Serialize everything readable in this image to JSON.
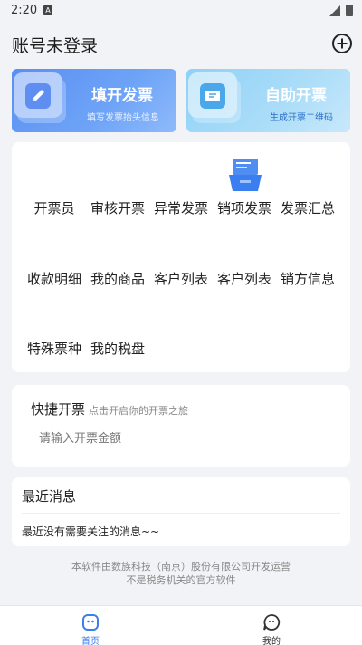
{
  "status": {
    "time": "2:20",
    "badge": "A"
  },
  "header": {
    "title": "账号未登录"
  },
  "cards": {
    "fill": {
      "title": "填开发票",
      "subtitle": "填写发票抬头信息"
    },
    "self": {
      "title": "自助开票",
      "subtitle": "生成开票二维码"
    }
  },
  "grid": {
    "items": [
      "开票员",
      "审核开票",
      "异常发票",
      "销项发票",
      "发票汇总",
      "收款明细",
      "我的商品",
      "客户列表",
      "客户列表",
      "销方信息",
      "特殊票种",
      "我的税盘"
    ]
  },
  "quick": {
    "title": "快捷开票",
    "hint": "点击开启你的开票之旅",
    "placeholder": "请输入开票金额"
  },
  "news": {
    "title": "最近消息",
    "empty": "最近没有需要关注的消息~~"
  },
  "footer": {
    "line1": "本软件由数族科技（南京）股份有限公司开发运营",
    "line2": "不是税务机关的官方软件"
  },
  "tabs": {
    "home": "首页",
    "mine": "我的"
  },
  "colors": {
    "accent": "#3b7ef0",
    "background": "#f2f3f7"
  }
}
